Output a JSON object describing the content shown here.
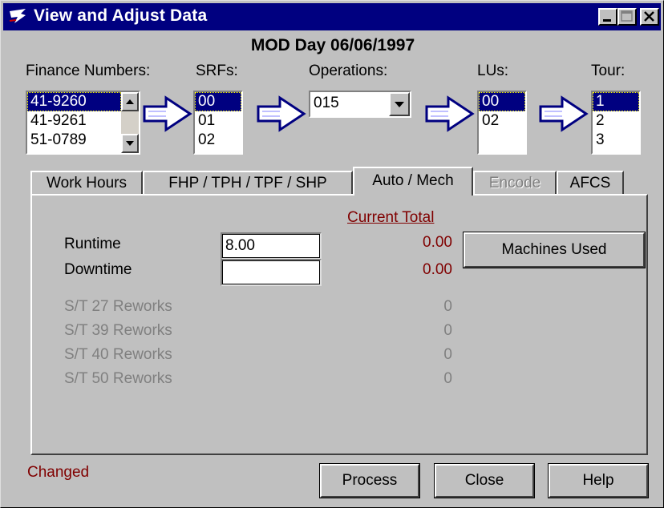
{
  "window": {
    "title": "View and Adjust Data",
    "heading": "MOD Day 06/06/1997"
  },
  "selectors": {
    "finance": {
      "label": "Finance Numbers:",
      "items": [
        "41-9260",
        "41-9261",
        "51-0789"
      ],
      "selected": "41-9260"
    },
    "srfs": {
      "label": "SRFs:",
      "items": [
        "00",
        "01",
        "02"
      ],
      "selected": "00"
    },
    "operations": {
      "label": "Operations:",
      "value": "015"
    },
    "lus": {
      "label": "LUs:",
      "items": [
        "00",
        "02"
      ],
      "selected": "00"
    },
    "tour": {
      "label": "Tour:",
      "items": [
        "1",
        "2",
        "3"
      ],
      "selected": "1"
    }
  },
  "tabs": [
    {
      "label": "Work Hours",
      "state": "normal"
    },
    {
      "label": "FHP / TPH / TPF / SHP",
      "state": "normal"
    },
    {
      "label": "Auto / Mech",
      "state": "active"
    },
    {
      "label": "Encode",
      "state": "disabled"
    },
    {
      "label": "AFCS",
      "state": "normal"
    }
  ],
  "panel": {
    "current_total_label": "Current Total",
    "runtime": {
      "label": "Runtime",
      "value": "8.00",
      "total": "0.00"
    },
    "downtime": {
      "label": "Downtime",
      "value": "",
      "total": "0.00"
    },
    "reworks": [
      {
        "label": "S/T 27 Reworks",
        "value": "0"
      },
      {
        "label": "S/T 39 Reworks",
        "value": "0"
      },
      {
        "label": "S/T 40 Reworks",
        "value": "0"
      },
      {
        "label": "S/T 50 Reworks",
        "value": "0"
      }
    ],
    "machines_button": "Machines Used"
  },
  "footer": {
    "status": "Changed",
    "process_button": "Process",
    "close_button": "Close",
    "help_button": "Help"
  },
  "colors": {
    "titlebar": "#000080",
    "selection": "#000080",
    "status_red": "#800000",
    "disabled_gray": "#808080"
  }
}
